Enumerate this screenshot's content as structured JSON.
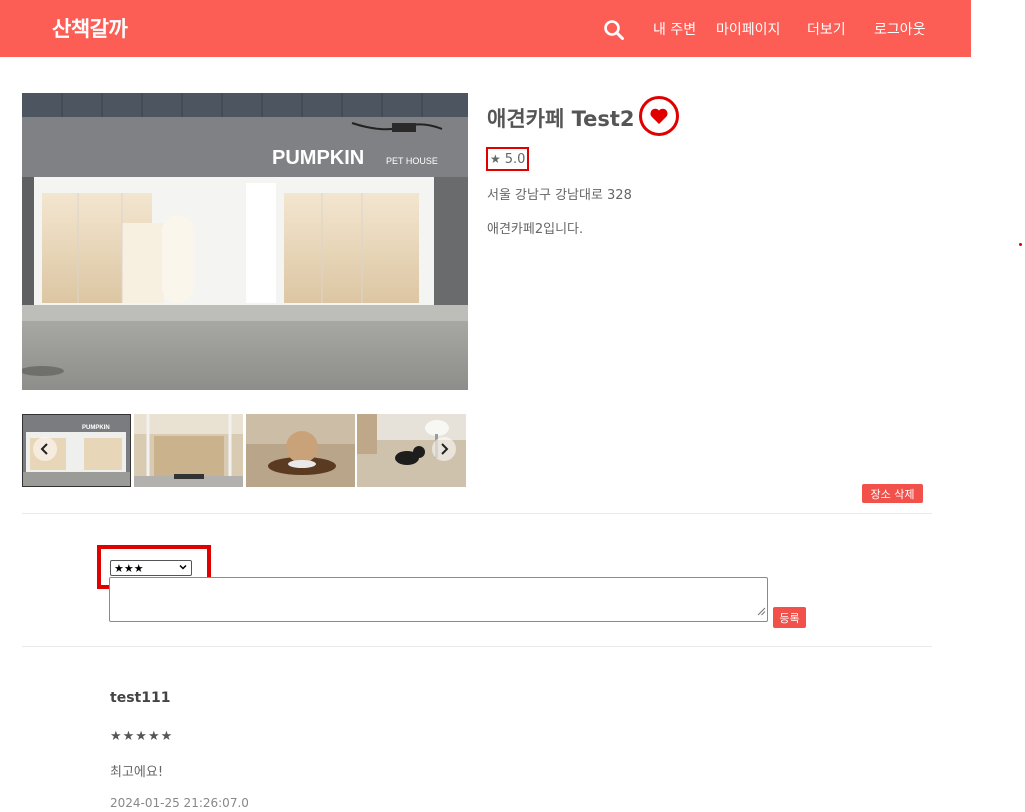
{
  "header": {
    "logo": "산책갈까",
    "search_icon": "search-icon",
    "nav": [
      "내 주변",
      "마이페이지",
      "더보기",
      "로그아웃"
    ]
  },
  "place": {
    "title": "애견카페 Test2",
    "favorite_icon": "heart-icon",
    "rating_star": "★",
    "rating": "5.0",
    "address": "서울 강남구 강남대로 328",
    "description": "애견카페2입니다.",
    "main_photo_sign": "PUMPKIN",
    "main_photo_sign_sub": "PET HOUSE",
    "thumb_sign": "PUMPKIN",
    "delete_label": "장소 삭제"
  },
  "review_form": {
    "selected_rating": "★★★",
    "submit_label": "등록"
  },
  "reviews": [
    {
      "user": "test111",
      "stars": "★★★★★",
      "text": "최고에요!",
      "date": "2024-01-25 21:26:07.0"
    }
  ],
  "colors": {
    "header_bg": "#fc5d55",
    "button_bg": "#f2504b",
    "highlight": "#e00000"
  }
}
